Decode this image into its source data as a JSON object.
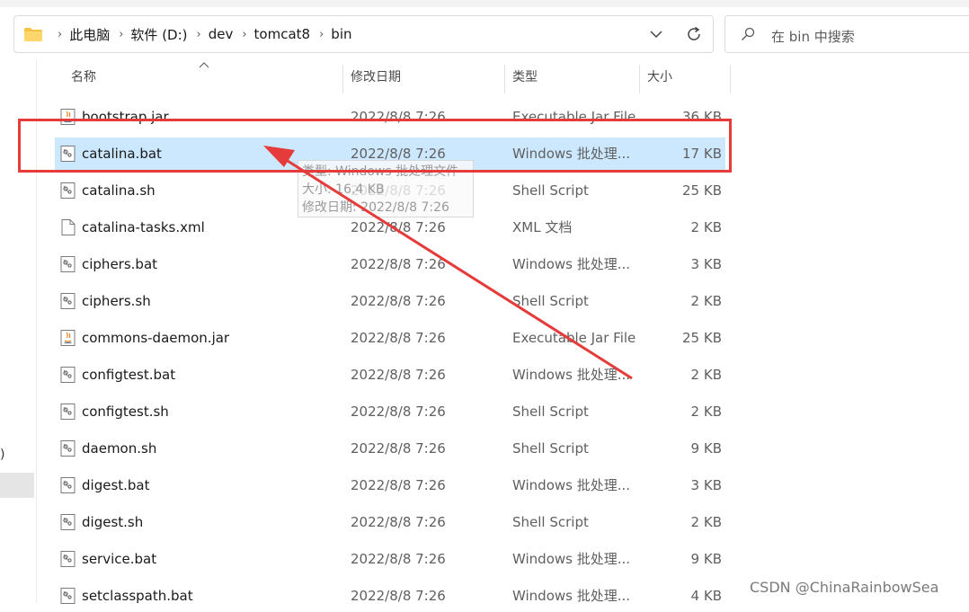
{
  "addressbar": {
    "crumbs": [
      "此电脑",
      "软件 (D:)",
      "dev",
      "tomcat8",
      "bin"
    ]
  },
  "search": {
    "placeholder": "在 bin 中搜索"
  },
  "columns": {
    "name": "名称",
    "date": "修改日期",
    "type": "类型",
    "size": "大小"
  },
  "files": [
    {
      "name": "bootstrap.jar",
      "date": "2022/8/8 7:26",
      "type": "Executable Jar File",
      "size": "36 KB",
      "icon": "java-jar-icon"
    },
    {
      "name": "catalina.bat",
      "date": "2022/8/8 7:26",
      "type": "Windows 批处理...",
      "size": "17 KB",
      "icon": "script-file-icon",
      "selected": true
    },
    {
      "name": "catalina.sh",
      "date": "2022/8/8 7:26",
      "type": "Shell Script",
      "size": "25 KB",
      "icon": "script-file-icon"
    },
    {
      "name": "catalina-tasks.xml",
      "date": "2022/8/8 7:26",
      "type": "XML 文档",
      "size": "2 KB",
      "icon": "blank-file-icon"
    },
    {
      "name": "ciphers.bat",
      "date": "2022/8/8 7:26",
      "type": "Windows 批处理...",
      "size": "3 KB",
      "icon": "script-file-icon"
    },
    {
      "name": "ciphers.sh",
      "date": "2022/8/8 7:26",
      "type": "Shell Script",
      "size": "2 KB",
      "icon": "script-file-icon"
    },
    {
      "name": "commons-daemon.jar",
      "date": "2022/8/8 7:26",
      "type": "Executable Jar File",
      "size": "25 KB",
      "icon": "java-jar-icon"
    },
    {
      "name": "configtest.bat",
      "date": "2022/8/8 7:26",
      "type": "Windows 批处理...",
      "size": "2 KB",
      "icon": "script-file-icon"
    },
    {
      "name": "configtest.sh",
      "date": "2022/8/8 7:26",
      "type": "Shell Script",
      "size": "2 KB",
      "icon": "script-file-icon"
    },
    {
      "name": "daemon.sh",
      "date": "2022/8/8 7:26",
      "type": "Shell Script",
      "size": "9 KB",
      "icon": "script-file-icon"
    },
    {
      "name": "digest.bat",
      "date": "2022/8/8 7:26",
      "type": "Windows 批处理...",
      "size": "3 KB",
      "icon": "script-file-icon"
    },
    {
      "name": "digest.sh",
      "date": "2022/8/8 7:26",
      "type": "Shell Script",
      "size": "2 KB",
      "icon": "script-file-icon"
    },
    {
      "name": "service.bat",
      "date": "2022/8/8 7:26",
      "type": "Windows 批处理...",
      "size": "9 KB",
      "icon": "script-file-icon"
    },
    {
      "name": "setclasspath.bat",
      "date": "2022/8/8 7:26",
      "type": "Windows 批处理...",
      "size": "4 KB",
      "icon": "script-file-icon"
    }
  ],
  "tooltip": {
    "type_line": "类型: Windows 批处理文件",
    "size_line": "大小: 16.4 KB",
    "date_line": "修改日期: 2022/8/8 7:26"
  },
  "nav": {
    "glyph": ")"
  },
  "watermark": "CSDN @ChinaRainbowSea",
  "colors": {
    "annotation": "#e53b3b",
    "selection": "#cce8ff"
  }
}
